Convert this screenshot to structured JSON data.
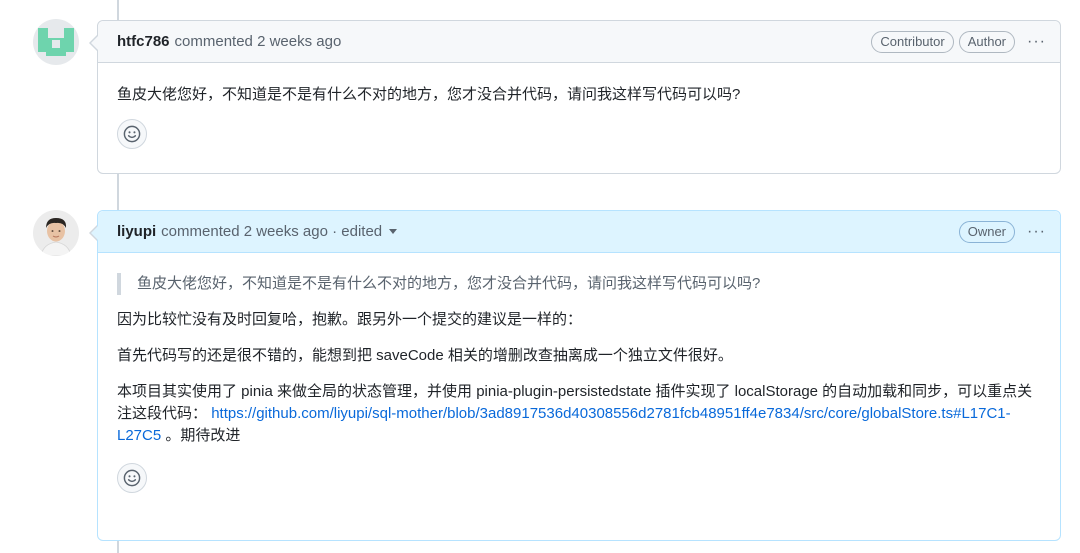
{
  "comments": [
    {
      "author": "htfc786",
      "meta": "commented 2 weeks ago",
      "badges": [
        "Contributor",
        "Author"
      ],
      "body": [
        "鱼皮大佬您好，不知道是不是有什么不对的地方，您才没合并代码，请问我这样写代码可以吗?"
      ]
    },
    {
      "author": "liyupi",
      "meta": "commented 2 weeks ago · edited",
      "badges": [
        "Owner"
      ],
      "quote": "鱼皮大佬您好，不知道是不是有什么不对的地方，您才没合并代码，请问我这样写代码可以吗?",
      "body": [
        "因为比较忙没有及时回复哈，抱歉。跟另外一个提交的建议是一样的：",
        "首先代码写的还是很不错的，能想到把 saveCode 相关的增删改查抽离成一个独立文件很好。",
        "本项目其实使用了 pinia 来做全局的状态管理，并使用 pinia-plugin-persistedstate 插件实现了 localStorage 的自动加载和同步，可以重点关注这段代码："
      ],
      "link": "https://github.com/liyupi/sql-mother/blob/3ad8917536d40308556d2781fcb48951ff4e7834/src/core/globalStore.ts#L17C1-L27C5",
      "link_suffix": "。期待改进"
    }
  ],
  "kebab_label": "···",
  "colors": {
    "header_default": "#f6f8fa",
    "header_owner": "#ddf4ff",
    "link": "#0969da"
  },
  "icons": {
    "kebab": "kebab-horizontal-icon",
    "reaction": "smiley-icon",
    "caret": "triangle-down-icon"
  }
}
